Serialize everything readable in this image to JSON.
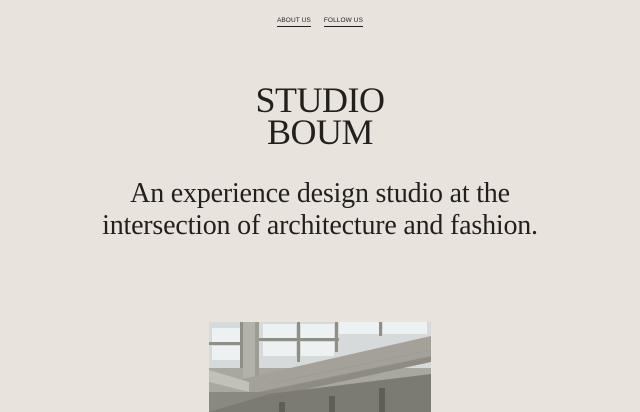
{
  "nav": {
    "items": [
      {
        "label": "ABOUT US"
      },
      {
        "label": "FOLLOW US"
      }
    ]
  },
  "logo": {
    "line1": "STUDIO",
    "line2": "BOUM"
  },
  "tagline": {
    "line1": "An experience design studio at the",
    "line2": "intersection of architecture and fashion."
  },
  "colors": {
    "background": "#e8e3dd",
    "text": "#231f1d"
  }
}
